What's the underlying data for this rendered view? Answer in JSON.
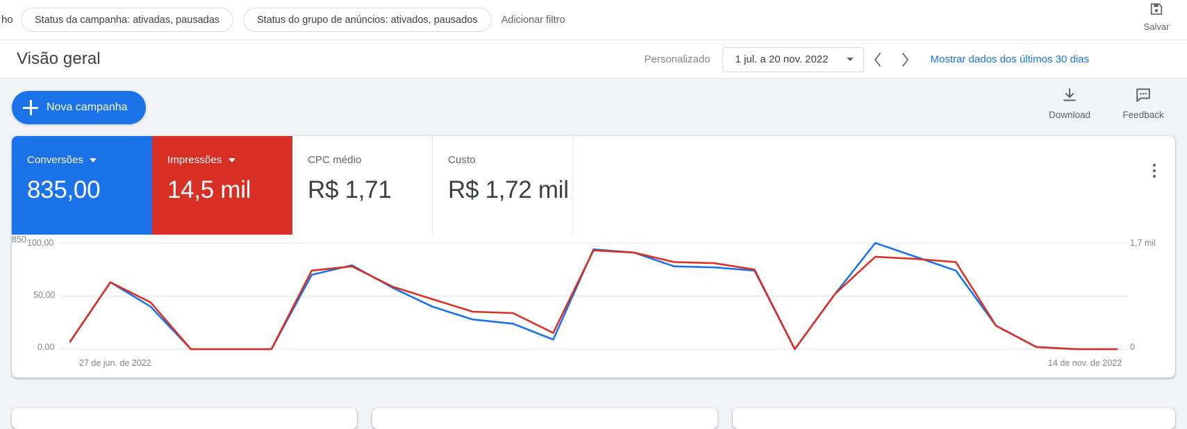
{
  "filter_bar": {
    "truncated_left_text": "ho",
    "chips": [
      "Status da campanha: ativadas, pausadas",
      "Status do grupo de anúncios: ativados, pausados"
    ],
    "add_filter_label": "Adicionar filtro",
    "save_label": "Salvar",
    "save_icon": "save-floppy-icon"
  },
  "header": {
    "title": "Visão geral",
    "date_mode_label": "Personalizado",
    "date_range": "1 jul. a 20 nov. 2022",
    "prev_icon": "chevron-left-icon",
    "next_icon": "chevron-right-icon",
    "last_30_days_link": "Mostrar dados dos últimos 30 dias"
  },
  "actions": {
    "new_campaign_label": "Nova campanha",
    "new_campaign_icon": "plus-icon",
    "download_label": "Download",
    "download_icon": "download-icon",
    "feedback_label": "Feedback",
    "feedback_icon": "feedback-icon"
  },
  "scorecards": [
    {
      "label": "Conversões",
      "value": "835,00",
      "state": "selected-blue",
      "color": "#1a73e8",
      "has_caret": true
    },
    {
      "label": "Impressões",
      "value": "14,5 mil",
      "state": "selected-red",
      "color": "#d93025",
      "has_caret": true
    },
    {
      "label": "CPC médio",
      "value": "R$ 1,71",
      "state": "plain",
      "color": "#ffffff",
      "has_caret": false
    },
    {
      "label": "Custo",
      "value": "R$ 1,72 mil",
      "state": "plain",
      "color": "#ffffff",
      "has_caret": false
    }
  ],
  "card_menu_icon": "kebab-menu-icon",
  "chart_data": {
    "type": "line",
    "title": "",
    "xlabel": "",
    "ylabel": "",
    "grid": true,
    "legend_position": "none",
    "x_tick_labels": [
      "27 de jun. de 2022",
      "14 de nov. de 2022"
    ],
    "left_axis": {
      "name": "Conversões",
      "color": "#1a73e8",
      "tick_labels": [
        "100,00",
        "50,00",
        "0,00"
      ],
      "ylim": [
        0,
        100
      ]
    },
    "right_axis": {
      "name": "Impressões",
      "color": "#d93025",
      "tick_labels": [
        "1,7 mil",
        "850",
        "0"
      ],
      "ylim": [
        0,
        1700
      ]
    },
    "series": [
      {
        "name": "Conversões",
        "color": "#1a73e8",
        "axis": "left",
        "values": [
          7,
          63,
          40,
          0,
          0,
          0,
          70,
          79,
          58,
          40,
          28,
          24,
          9,
          94,
          91,
          78,
          77,
          74,
          0,
          52,
          100,
          87,
          74,
          22,
          2,
          0,
          0
        ]
      },
      {
        "name": "Impressões",
        "color": "#d93025",
        "axis": "right",
        "values": [
          122,
          1071,
          748,
          0,
          0,
          0,
          1258,
          1326,
          1003,
          800,
          600,
          578,
          260,
          1581,
          1547,
          1394,
          1377,
          1275,
          0,
          884,
          1479,
          1445,
          1394,
          374,
          34,
          0,
          0
        ]
      }
    ]
  }
}
